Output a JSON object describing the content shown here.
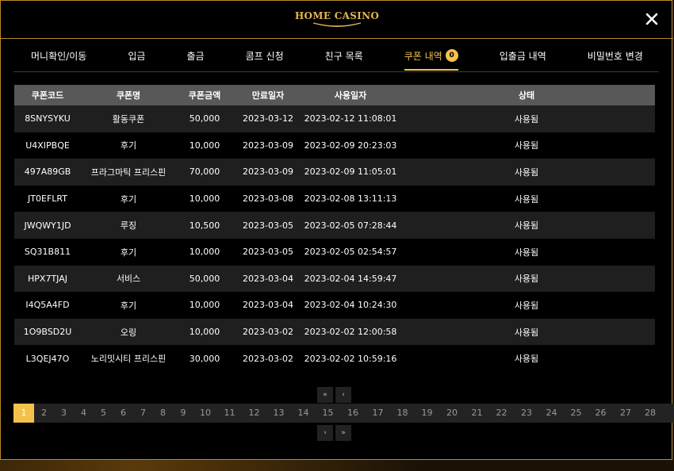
{
  "header": {
    "logo_text": "HOME CASINO",
    "close_label": "✕"
  },
  "tabs": [
    {
      "label": "머니확인/이동"
    },
    {
      "label": "입금"
    },
    {
      "label": "출금"
    },
    {
      "label": "콤프 신청"
    },
    {
      "label": "친구 목록"
    },
    {
      "label": "쿠폰 내역",
      "badge": "0",
      "active": true
    },
    {
      "label": "입출금 내역"
    },
    {
      "label": "비밀번호 변경"
    }
  ],
  "table": {
    "columns": [
      "쿠폰코드",
      "쿠폰명",
      "쿠폰금액",
      "만료일자",
      "사용일자",
      "상태"
    ],
    "rows": [
      [
        "8SNYSYKU",
        "활동쿠폰",
        "50,000",
        "2023-03-12",
        "2023-02-12 11:08:01",
        "사용됨"
      ],
      [
        "U4XIPBQE",
        "후기",
        "10,000",
        "2023-03-09",
        "2023-02-09 20:23:03",
        "사용됨"
      ],
      [
        "497A89GB",
        "프라그마틱 프리스핀",
        "70,000",
        "2023-03-09",
        "2023-02-09 11:05:01",
        "사용됨"
      ],
      [
        "JT0EFLRT",
        "후기",
        "10,000",
        "2023-03-08",
        "2023-02-08 13:11:13",
        "사용됨"
      ],
      [
        "JWQWY1JD",
        "루징",
        "10,500",
        "2023-03-05",
        "2023-02-05 07:28:44",
        "사용됨"
      ],
      [
        "SQ31B811",
        "후기",
        "10,000",
        "2023-03-05",
        "2023-02-05 02:54:57",
        "사용됨"
      ],
      [
        "HPX7TJAJ",
        "서비스",
        "50,000",
        "2023-03-04",
        "2023-02-04 14:59:47",
        "사용됨"
      ],
      [
        "I4Q5A4FD",
        "후기",
        "10,000",
        "2023-03-04",
        "2023-02-04 10:24:30",
        "사용됨"
      ],
      [
        "1O9BSD2U",
        "오링",
        "10,000",
        "2023-03-02",
        "2023-02-02 12:00:58",
        "사용됨"
      ],
      [
        "L3QEJ47O",
        "노리밋시티 프리스핀",
        "30,000",
        "2023-03-02",
        "2023-02-02 10:59:16",
        "사용됨"
      ]
    ]
  },
  "pagination": {
    "first": "«",
    "prev": "‹",
    "next": "›",
    "last": "»",
    "current": "1",
    "pages": [
      "1",
      "2",
      "3",
      "4",
      "5",
      "6",
      "7",
      "8",
      "9",
      "10",
      "11",
      "12",
      "13",
      "14",
      "15",
      "16",
      "17",
      "18",
      "19",
      "20",
      "21",
      "22",
      "23",
      "24",
      "25",
      "26",
      "27",
      "28"
    ]
  },
  "colors": {
    "accent": "#f4c24a",
    "border": "#b88a2c",
    "header_bg": "#585858"
  }
}
